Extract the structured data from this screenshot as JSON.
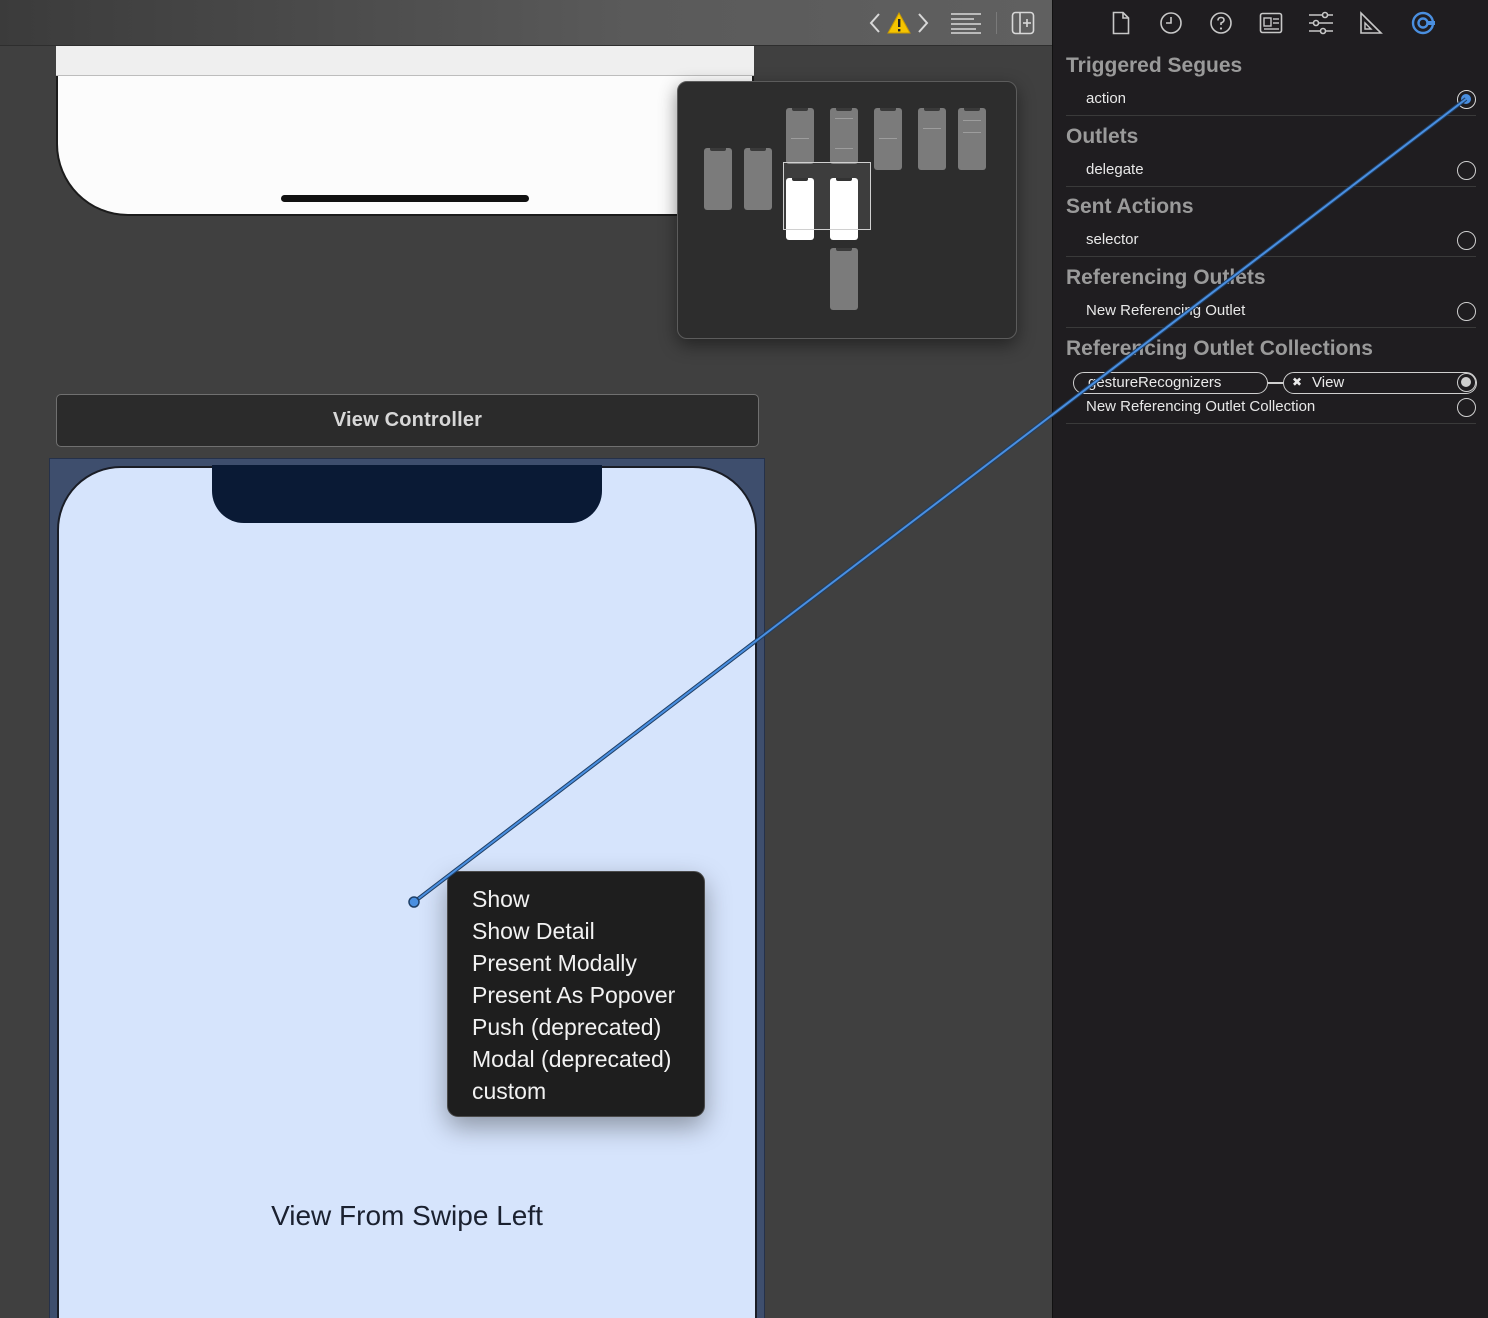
{
  "toolbar": {
    "icons": [
      "chevron-left-icon",
      "warning-icon",
      "chevron-right-icon",
      "outline-icon",
      "add-editor-icon"
    ]
  },
  "scene": {
    "title": "View Controller",
    "view_label": "View From Swipe Left"
  },
  "segue_menu": {
    "items": [
      "Show",
      "Show Detail",
      "Present Modally",
      "Present As Popover",
      "Push (deprecated)",
      "Modal (deprecated)",
      "custom"
    ]
  },
  "inspector": {
    "tabs": [
      "file-icon",
      "history-icon",
      "help-icon",
      "identity-icon",
      "attributes-icon",
      "size-icon",
      "connections-icon"
    ],
    "sections": {
      "triggered_segues": {
        "title": "Triggered Segues",
        "rows": [
          "action"
        ]
      },
      "outlets": {
        "title": "Outlets",
        "rows": [
          "delegate"
        ]
      },
      "sent_actions": {
        "title": "Sent Actions",
        "rows": [
          "selector"
        ]
      },
      "referencing_outlets": {
        "title": "Referencing Outlets",
        "rows": [
          "New Referencing Outlet"
        ]
      },
      "referencing_outlet_collections": {
        "title": "Referencing Outlet Collections",
        "connection": {
          "outlet": "gestureRecognizers",
          "target": "View"
        },
        "rows": [
          "New Referencing Outlet Collection"
        ]
      }
    }
  },
  "colors": {
    "accent": "#4a8fe0",
    "canvas": "#404040",
    "inspector_bg": "#1f1d20",
    "scene_bg": "#d6e4fc",
    "warning": "#f5c400"
  }
}
